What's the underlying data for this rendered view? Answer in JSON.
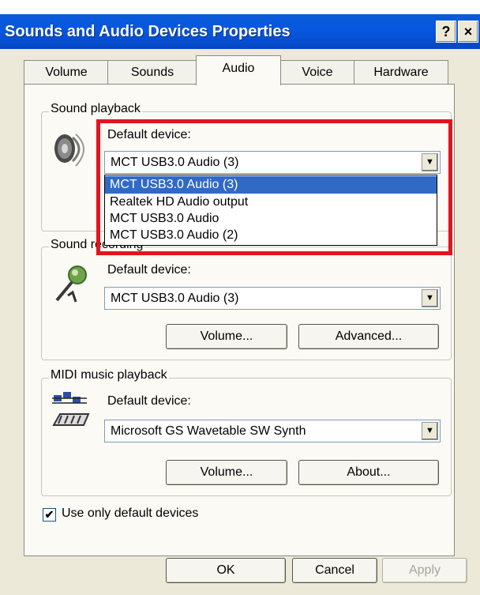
{
  "window": {
    "title": "Sounds and Audio Devices Properties",
    "help_button": "?",
    "close_button": "×"
  },
  "tabs": [
    {
      "label": "Volume"
    },
    {
      "label": "Sounds"
    },
    {
      "label": "Audio"
    },
    {
      "label": "Voice"
    },
    {
      "label": "Hardware"
    }
  ],
  "active_tab": "Audio",
  "playback": {
    "group_label": "Sound playback",
    "default_device_label": "Default device:",
    "selected": "MCT USB3.0 Audio (3)",
    "options": [
      "MCT USB3.0 Audio (3)",
      "Realtek HD Audio output",
      "MCT USB3.0 Audio",
      "MCT USB3.0 Audio (2)"
    ]
  },
  "recording": {
    "group_label": "Sound recording",
    "default_device_label": "Default device:",
    "selected": "MCT USB3.0 Audio (3)",
    "volume_button": "Volume...",
    "advanced_button": "Advanced..."
  },
  "midi": {
    "group_label": "MIDI music playback",
    "default_device_label": "Default device:",
    "selected": "Microsoft GS Wavetable SW Synth",
    "volume_button": "Volume...",
    "about_button": "About..."
  },
  "use_default_only": {
    "label": "Use only default devices",
    "checked": true,
    "mark": "✔"
  },
  "footer": {
    "ok": "OK",
    "cancel": "Cancel",
    "apply": "Apply"
  },
  "icons": {
    "speaker": "speaker-icon",
    "microphone": "microphone-icon",
    "midi": "midi-keyboard-icon",
    "dropdown_arrow": "▼"
  },
  "colors": {
    "titlebar": "#0757e0",
    "selection": "#316ac5",
    "highlight_box": "#e2141f"
  }
}
